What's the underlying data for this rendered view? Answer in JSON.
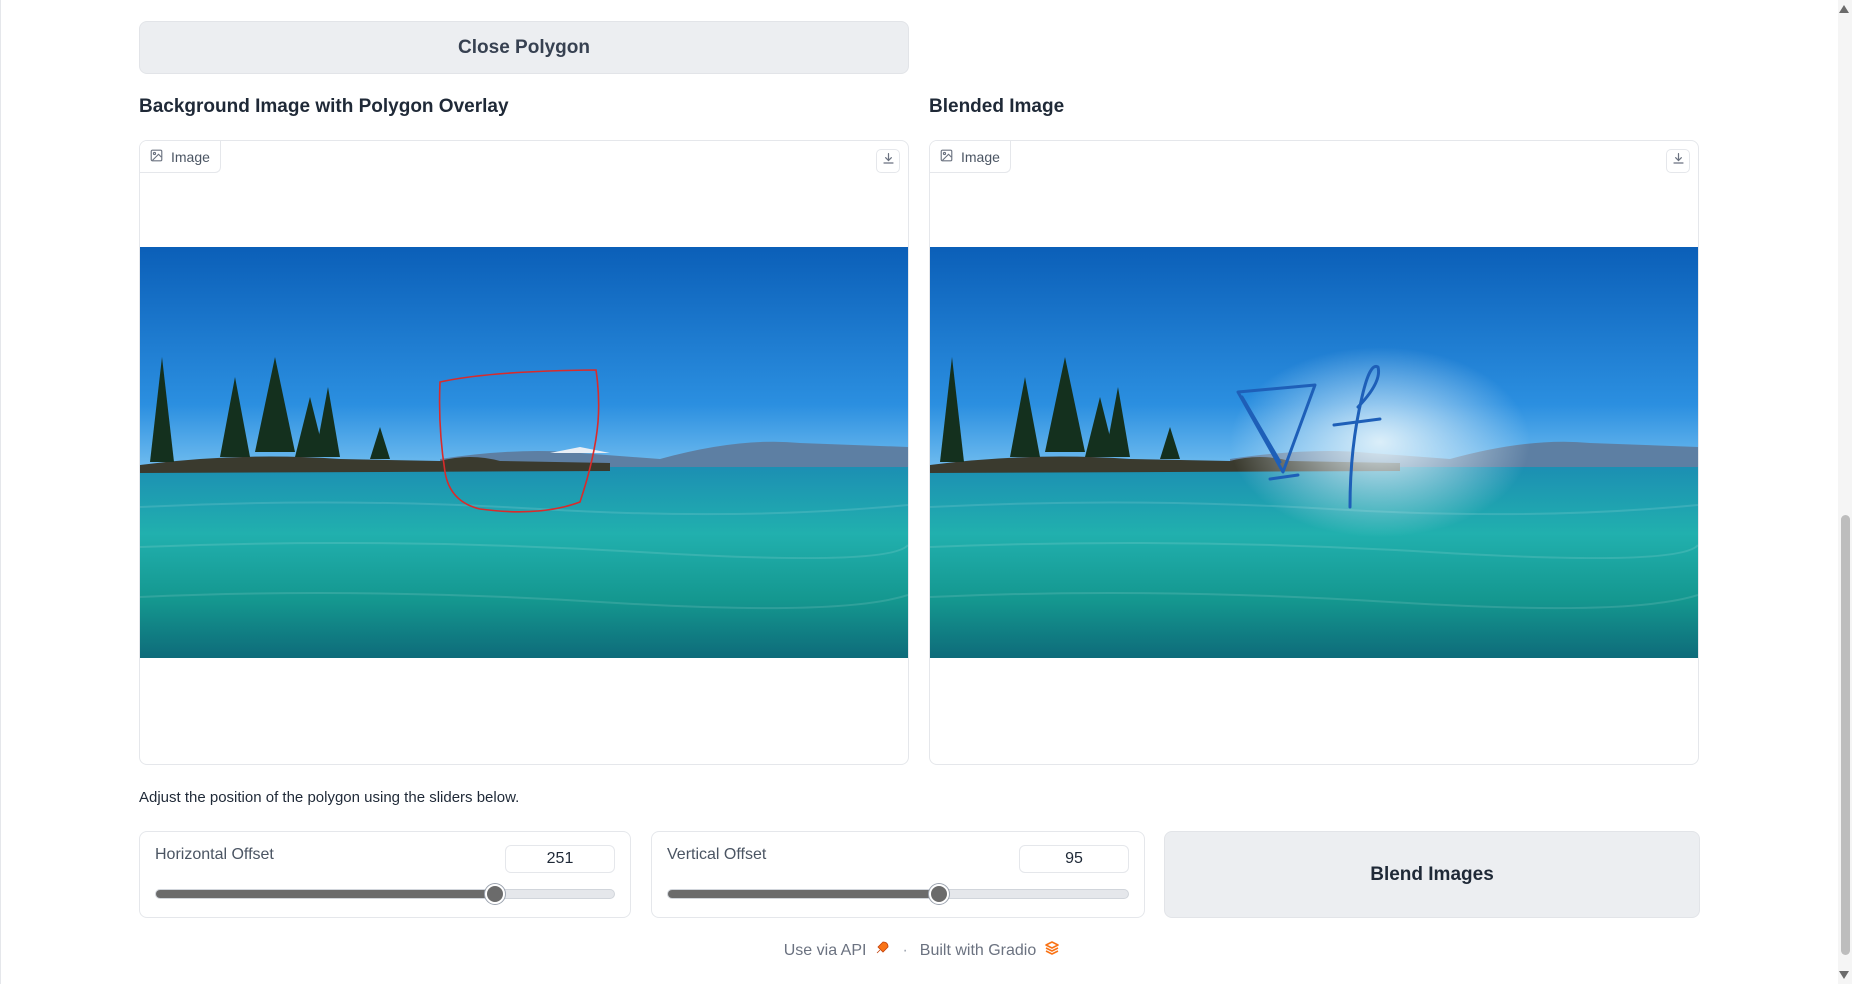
{
  "close_button": {
    "label": "Close Polygon"
  },
  "left_panel": {
    "title": "Background Image with Polygon Overlay",
    "image_label": "Image",
    "image_icon": "image-icon",
    "download_icon": "download-icon"
  },
  "right_panel": {
    "title": "Blended Image",
    "image_label": "Image",
    "image_icon": "image-icon",
    "download_icon": "download-icon"
  },
  "hint": "Adjust the position of the polygon using the sliders below.",
  "sliders": {
    "horizontal": {
      "label": "Horizontal Offset",
      "value": "251",
      "fraction": 0.74
    },
    "vertical": {
      "label": "Vertical Offset",
      "value": "95",
      "fraction": 0.59
    }
  },
  "blend_button": {
    "label": "Blend Images"
  },
  "footer": {
    "api_label": "Use via API",
    "separator": "·",
    "built_label": "Built with Gradio",
    "api_icon": "rocket-icon",
    "gradio_icon": "gradio-logo-icon"
  },
  "colors": {
    "polygon_stroke": "#d92b2b",
    "blend_stroke": "#1e5fb8",
    "sky": "#1279cf",
    "water": "#1fb3a8",
    "gradio_orange": "#f97316"
  }
}
